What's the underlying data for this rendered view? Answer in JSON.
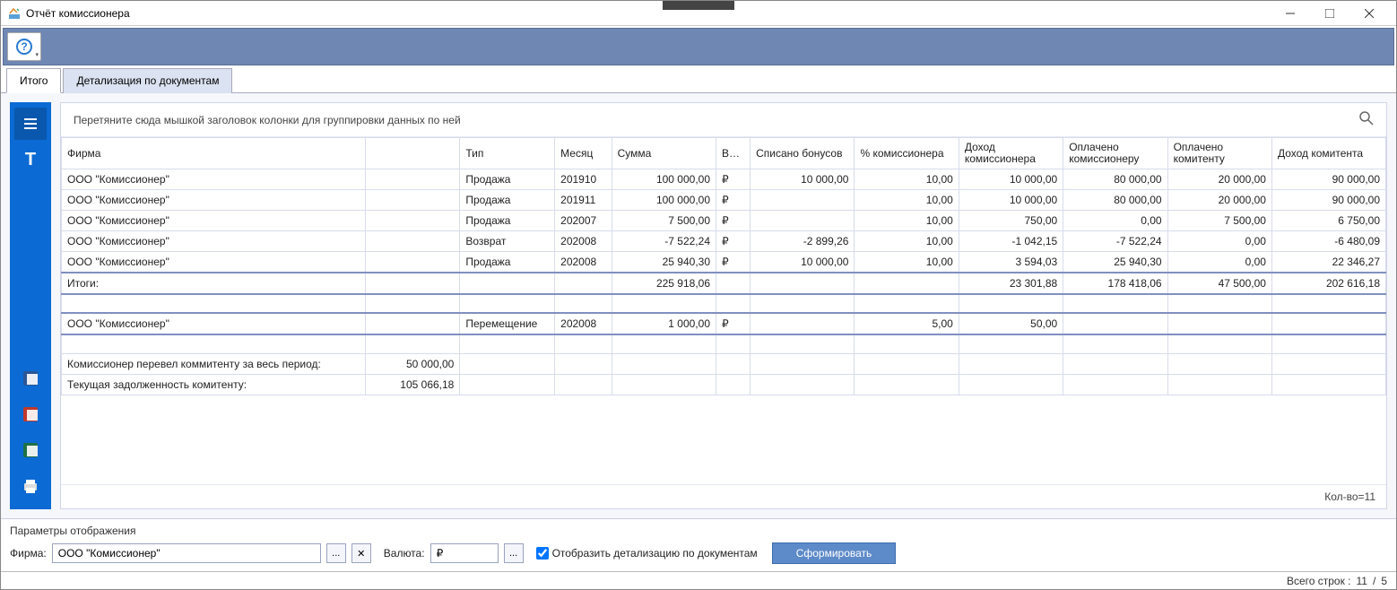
{
  "window": {
    "title": "Отчёт комиссионера"
  },
  "tabs": {
    "total": "Итого",
    "detail": "Детализация по документам"
  },
  "grid": {
    "group_hint": "Перетяните сюда мышкой заголовок колонки для группировки данных по ней",
    "headers": {
      "firm": "Фирма",
      "type": "Тип",
      "month": "Месяц",
      "sum": "Сумма",
      "currency": "Валюта",
      "bonus": "Списано бонусов",
      "pct": "% комиссионера",
      "income_k": "Доход комиссионера",
      "paid_k": "Оплачено комиссионеру",
      "paid_m": "Оплачено комитенту",
      "income_m": "Доход комитента"
    },
    "rows": [
      {
        "firm": "ООО \"Комиссионер\"",
        "type": "Продажа",
        "month": "201910",
        "sum": "100 000,00",
        "cur": "₽",
        "bonus": "10 000,00",
        "pct": "10,00",
        "income_k": "10 000,00",
        "paid_k": "80 000,00",
        "paid_m": "20 000,00",
        "income_m": "90 000,00"
      },
      {
        "firm": "ООО \"Комиссионер\"",
        "type": "Продажа",
        "month": "201911",
        "sum": "100 000,00",
        "cur": "₽",
        "bonus": "",
        "pct": "10,00",
        "income_k": "10 000,00",
        "paid_k": "80 000,00",
        "paid_m": "20 000,00",
        "income_m": "90 000,00"
      },
      {
        "firm": "ООО \"Комиссионер\"",
        "type": "Продажа",
        "month": "202007",
        "sum": "7 500,00",
        "cur": "₽",
        "bonus": "",
        "pct": "10,00",
        "income_k": "750,00",
        "paid_k": "0,00",
        "paid_m": "7 500,00",
        "income_m": "6 750,00"
      },
      {
        "firm": "ООО \"Комиссионер\"",
        "type": "Возврат",
        "month": "202008",
        "sum": "-7 522,24",
        "cur": "₽",
        "bonus": "-2 899,26",
        "pct": "10,00",
        "income_k": "-1 042,15",
        "paid_k": "-7 522,24",
        "paid_m": "0,00",
        "income_m": "-6 480,09"
      },
      {
        "firm": "ООО \"Комиссионер\"",
        "type": "Продажа",
        "month": "202008",
        "sum": "25 940,30",
        "cur": "₽",
        "bonus": "10 000,00",
        "pct": "10,00",
        "income_k": "3 594,03",
        "paid_k": "25 940,30",
        "paid_m": "0,00",
        "income_m": "22 346,27"
      }
    ],
    "totals": {
      "label": "Итоги:",
      "sum": "225 918,06",
      "income_k": "23 301,88",
      "paid_k": "178 418,06",
      "paid_m": "47 500,00",
      "income_m": "202 616,18"
    },
    "row2": {
      "firm": "ООО \"Комиссионер\"",
      "type": "Перемещение",
      "month": "202008",
      "sum": "1 000,00",
      "cur": "₽",
      "pct": "5,00",
      "income_k": "50,00"
    },
    "summary1": {
      "label": "Комиссионер перевел коммитенту за весь период:",
      "val": "50 000,00"
    },
    "summary2": {
      "label": "Текущая задолженность комитенту:",
      "val": "105 066,18"
    },
    "count_label": "Кол-во=11"
  },
  "params": {
    "title": "Параметры отображения",
    "firm_label": "Фирма:",
    "firm_value": "ООО \"Комиссионер\"",
    "cur_label": "Валюта:",
    "cur_value": "₽",
    "detail_chk": "Отобразить детализацию по документам",
    "submit": "Сформировать"
  },
  "status": {
    "label": "Всего строк :",
    "count": "11",
    "sep": "/",
    "total": "5"
  }
}
